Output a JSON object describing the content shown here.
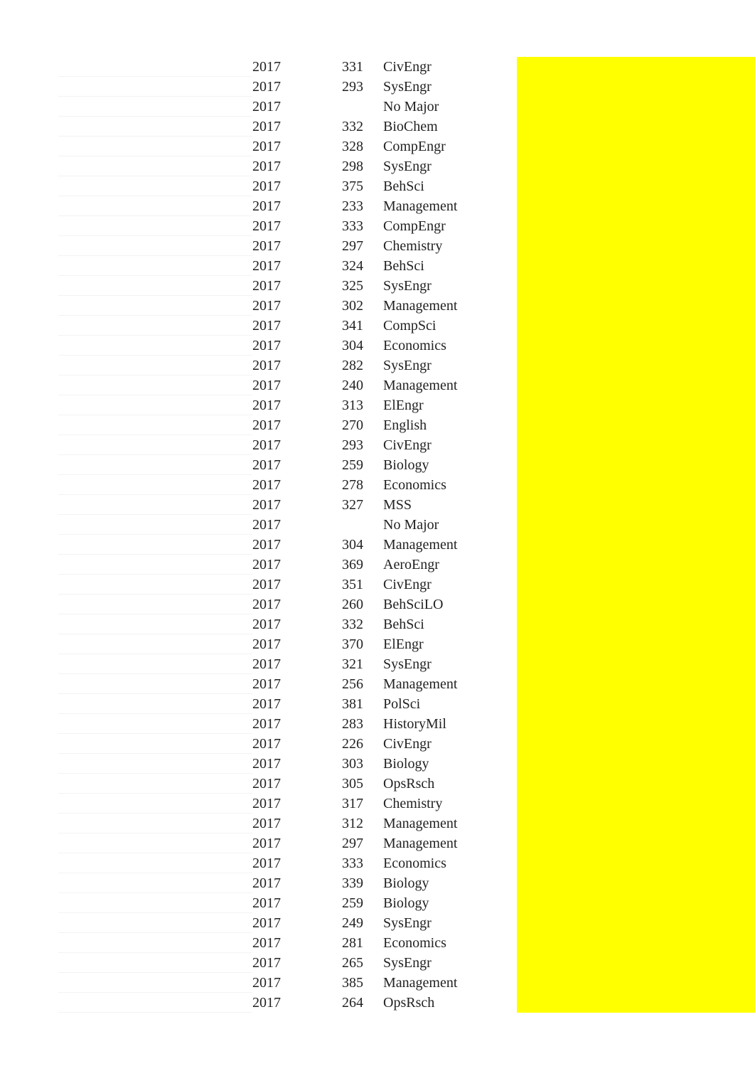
{
  "rows": [
    {
      "year": "2017",
      "num": "331",
      "major": "CivEngr"
    },
    {
      "year": "2017",
      "num": "293",
      "major": "SysEngr"
    },
    {
      "year": "2017",
      "num": "",
      "major": "No Major"
    },
    {
      "year": "2017",
      "num": "332",
      "major": "BioChem"
    },
    {
      "year": "2017",
      "num": "328",
      "major": "CompEngr"
    },
    {
      "year": "2017",
      "num": "298",
      "major": "SysEngr"
    },
    {
      "year": "2017",
      "num": "375",
      "major": "BehSci"
    },
    {
      "year": "2017",
      "num": "233",
      "major": "Management"
    },
    {
      "year": "2017",
      "num": "333",
      "major": "CompEngr"
    },
    {
      "year": "2017",
      "num": "297",
      "major": "Chemistry"
    },
    {
      "year": "2017",
      "num": "324",
      "major": "BehSci"
    },
    {
      "year": "2017",
      "num": "325",
      "major": "SysEngr"
    },
    {
      "year": "2017",
      "num": "302",
      "major": "Management"
    },
    {
      "year": "2017",
      "num": "341",
      "major": "CompSci"
    },
    {
      "year": "2017",
      "num": "304",
      "major": "Economics"
    },
    {
      "year": "2017",
      "num": "282",
      "major": "SysEngr"
    },
    {
      "year": "2017",
      "num": "240",
      "major": "Management"
    },
    {
      "year": "2017",
      "num": "313",
      "major": "ElEngr"
    },
    {
      "year": "2017",
      "num": "270",
      "major": "English"
    },
    {
      "year": "2017",
      "num": "293",
      "major": "CivEngr"
    },
    {
      "year": "2017",
      "num": "259",
      "major": "Biology"
    },
    {
      "year": "2017",
      "num": "278",
      "major": "Economics"
    },
    {
      "year": "2017",
      "num": "327",
      "major": "MSS"
    },
    {
      "year": "2017",
      "num": "",
      "major": "No Major"
    },
    {
      "year": "2017",
      "num": "304",
      "major": "Management"
    },
    {
      "year": "2017",
      "num": "369",
      "major": "AeroEngr"
    },
    {
      "year": "2017",
      "num": "351",
      "major": "CivEngr"
    },
    {
      "year": "2017",
      "num": "260",
      "major": "BehSciLO"
    },
    {
      "year": "2017",
      "num": "332",
      "major": "BehSci"
    },
    {
      "year": "2017",
      "num": "370",
      "major": "ElEngr"
    },
    {
      "year": "2017",
      "num": "321",
      "major": "SysEngr"
    },
    {
      "year": "2017",
      "num": "256",
      "major": "Management"
    },
    {
      "year": "2017",
      "num": "381",
      "major": "PolSci"
    },
    {
      "year": "2017",
      "num": "283",
      "major": "HistoryMil"
    },
    {
      "year": "2017",
      "num": "226",
      "major": "CivEngr"
    },
    {
      "year": "2017",
      "num": "303",
      "major": "Biology"
    },
    {
      "year": "2017",
      "num": "305",
      "major": "OpsRsch"
    },
    {
      "year": "2017",
      "num": "317",
      "major": "Chemistry"
    },
    {
      "year": "2017",
      "num": "312",
      "major": "Management"
    },
    {
      "year": "2017",
      "num": "297",
      "major": "Management"
    },
    {
      "year": "2017",
      "num": "333",
      "major": "Economics"
    },
    {
      "year": "2017",
      "num": "339",
      "major": "Biology"
    },
    {
      "year": "2017",
      "num": "259",
      "major": "Biology"
    },
    {
      "year": "2017",
      "num": "249",
      "major": "SysEngr"
    },
    {
      "year": "2017",
      "num": "281",
      "major": "Economics"
    },
    {
      "year": "2017",
      "num": "265",
      "major": "SysEngr"
    },
    {
      "year": "2017",
      "num": "385",
      "major": "Management"
    },
    {
      "year": "2017",
      "num": "264",
      "major": "OpsRsch"
    }
  ]
}
